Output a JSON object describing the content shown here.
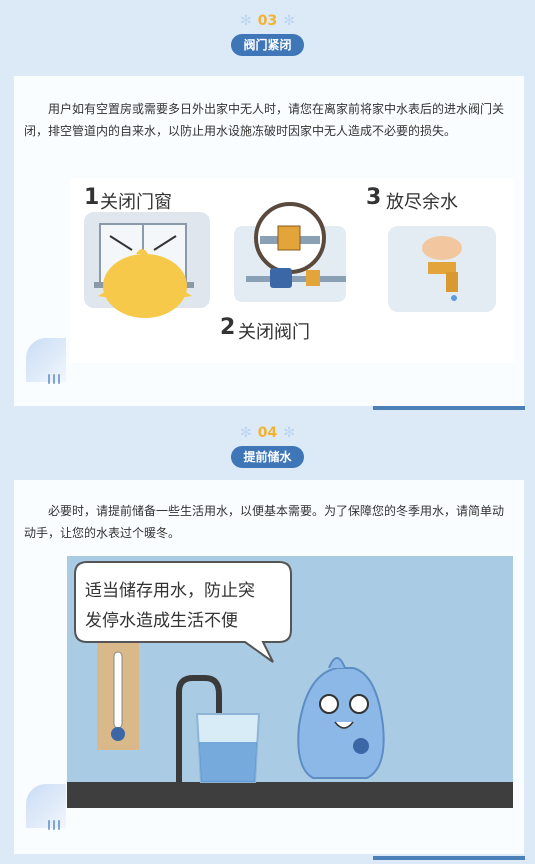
{
  "section3": {
    "number": "03",
    "title": "阀门紧闭",
    "text": "用户如有空置房或需要多日外出家中无人时，请您在离家前将家中水表后的进水阀门关闭，排空管道内的自来水，以防止用水设施冻破时因家中无人造成不必要的损失。",
    "steps": [
      {
        "num": "1",
        "label": "关闭门窗"
      },
      {
        "num": "2",
        "label": "关闭阀门"
      },
      {
        "num": "3",
        "label": "放尽余水"
      }
    ]
  },
  "section4": {
    "number": "04",
    "title": "提前储水",
    "text": "必要时，请提前储备一些生活用水，以便基本需要。为了保障您的冬季用水，请简单动动手，让您的水表过个暖冬。",
    "bubble_line1": "适当储存用水，防止突",
    "bubble_line2": "发停水造成生活不便"
  },
  "colors": {
    "accent": "#3f76b8",
    "number": "#f2b233",
    "background": "#dceaf8"
  }
}
